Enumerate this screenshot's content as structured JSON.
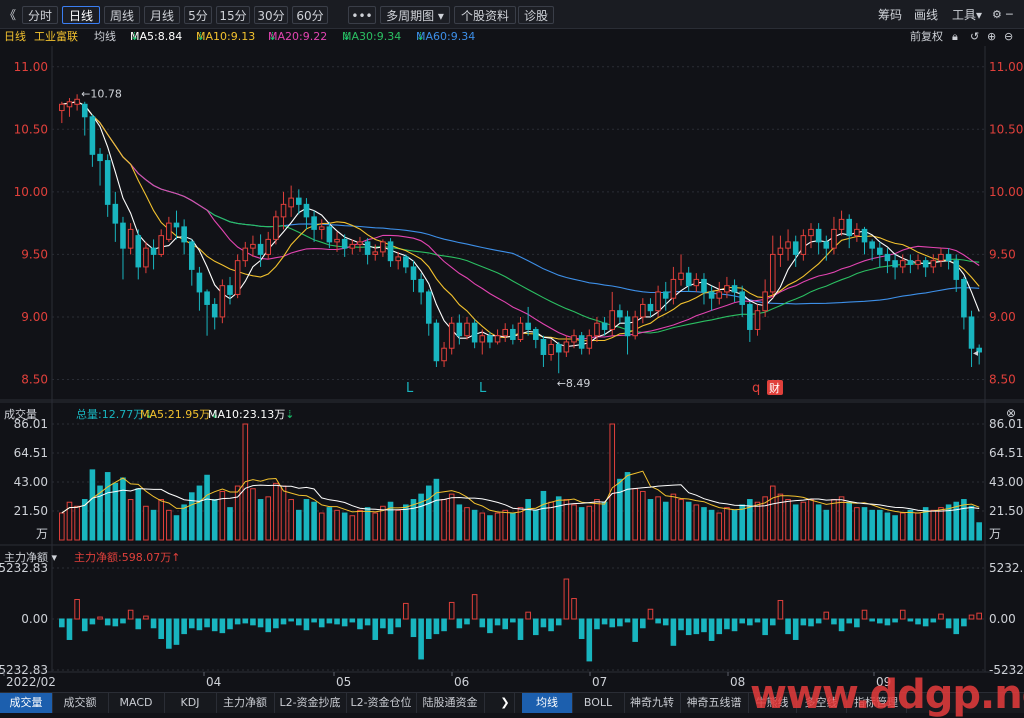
{
  "toolbar": {
    "back": "《",
    "periods": [
      "分时",
      "日线",
      "周线",
      "月线",
      "5分",
      "15分",
      "30分",
      "60分"
    ],
    "active_period": "日线",
    "more": "•••",
    "multi_period": "多周期图",
    "stock_info": "个股资料",
    "diagnose": "诊股",
    "right_items": [
      "筹码",
      "画线",
      "工具"
    ],
    "window_controls": [
      "⚙",
      "─",
      "▢",
      "✕"
    ]
  },
  "ribbon": {
    "period": "日线",
    "stock_name": "工业富联",
    "avg_label": "均线",
    "ma5": "MA5:8.84",
    "ma10": "MA10:9.13",
    "ma20": "MA20:9.22",
    "ma30": "MA30:9.34",
    "ma60": "MA60:9.34",
    "adjust": "前复权"
  },
  "colors": {
    "up": "#e0403b",
    "down": "#19b5bf",
    "ma5": "#ffffff",
    "ma10": "#f2c12e",
    "ma20": "#e244b1",
    "ma30": "#2bbf62",
    "ma60": "#3d8fe8",
    "grid": "#2a2d35",
    "axis_text": "#e0403b"
  },
  "price_panel": {
    "y_ticks": [
      "11.00",
      "10.50",
      "10.00",
      "9.50",
      "9.00",
      "8.50"
    ],
    "high_label": "10.78",
    "low_label": "8.49",
    "markers": [
      "L",
      "L",
      "q"
    ],
    "finance_badge": "财"
  },
  "volume_panel": {
    "title": "成交量",
    "total": "总量:12.77万",
    "ma5": "MA5:21.95万",
    "ma10": "MA10:23.13万",
    "y_ticks": [
      "86.01",
      "64.51",
      "43.00",
      "21.50",
      "万"
    ]
  },
  "flow_panel": {
    "title": "主力净额",
    "value": "主力净额:598.07万",
    "y_ticks": [
      "5232.83",
      "0.00",
      "-5232.83"
    ]
  },
  "x_axis": {
    "labels": [
      "2022/02",
      "04",
      "05",
      "06",
      "07",
      "08",
      "09"
    ]
  },
  "bottom_tabs_left": [
    "成交量",
    "成交额",
    "MACD",
    "KDJ",
    "主力净额",
    "L2-资金抄底",
    "L2-资金仓位",
    "陆股通资金"
  ],
  "bottom_tabs_right": [
    "均线",
    "BOLL",
    "神奇九转",
    "神奇五线谱",
    "牛熊线",
    "多空线",
    "指标管理"
  ],
  "active_left_tab": "成交量",
  "active_right_tab": "均线",
  "watermark": "www.ddgp.net",
  "chart_data": {
    "type": "candlestick",
    "title": "工业富联 日线",
    "price_range": [
      8.4,
      11.15
    ],
    "volume_range": [
      0,
      86.01
    ],
    "flow_range": [
      -5232.83,
      5232.83
    ],
    "candles": [
      [
        10.65,
        10.7,
        10.55,
        10.72,
        20
      ],
      [
        10.68,
        10.72,
        10.6,
        10.75,
        28
      ],
      [
        10.7,
        10.74,
        10.65,
        10.78,
        25
      ],
      [
        10.7,
        10.6,
        10.45,
        10.72,
        30
      ],
      [
        10.6,
        10.3,
        10.2,
        10.62,
        52
      ],
      [
        10.3,
        10.25,
        10.05,
        10.35,
        40
      ],
      [
        10.25,
        9.9,
        9.8,
        10.3,
        50
      ],
      [
        9.9,
        9.75,
        9.6,
        10.0,
        42
      ],
      [
        9.75,
        9.55,
        9.3,
        9.8,
        46
      ],
      [
        9.55,
        9.7,
        9.5,
        9.75,
        30
      ],
      [
        9.65,
        9.4,
        9.3,
        9.7,
        38
      ],
      [
        9.4,
        9.55,
        9.35,
        9.6,
        25
      ],
      [
        9.55,
        9.5,
        9.38,
        9.62,
        22
      ],
      [
        9.5,
        9.65,
        9.48,
        9.7,
        30
      ],
      [
        9.62,
        9.75,
        9.6,
        9.8,
        22
      ],
      [
        9.75,
        9.72,
        9.62,
        9.85,
        18
      ],
      [
        9.72,
        9.6,
        9.5,
        9.78,
        26
      ],
      [
        9.6,
        9.38,
        9.25,
        9.62,
        35
      ],
      [
        9.35,
        9.2,
        9.05,
        9.4,
        40
      ],
      [
        9.2,
        9.1,
        8.85,
        9.22,
        48
      ],
      [
        9.1,
        9.0,
        8.9,
        9.15,
        30
      ],
      [
        9.0,
        9.25,
        8.95,
        9.3,
        36
      ],
      [
        9.25,
        9.18,
        9.1,
        9.32,
        24
      ],
      [
        9.18,
        9.45,
        9.15,
        9.5,
        40
      ],
      [
        9.45,
        9.55,
        9.4,
        9.6,
        86
      ],
      [
        9.55,
        9.58,
        9.48,
        9.65,
        38
      ],
      [
        9.58,
        9.5,
        9.4,
        9.66,
        30
      ],
      [
        9.5,
        9.62,
        9.46,
        9.68,
        32
      ],
      [
        9.62,
        9.8,
        9.58,
        9.85,
        42
      ],
      [
        9.8,
        9.9,
        9.7,
        10.0,
        40
      ],
      [
        9.88,
        9.95,
        9.8,
        10.05,
        30
      ],
      [
        9.95,
        9.9,
        9.82,
        10.02,
        22
      ],
      [
        9.9,
        9.8,
        9.7,
        9.95,
        30
      ],
      [
        9.8,
        9.7,
        9.6,
        9.85,
        28
      ],
      [
        9.7,
        9.72,
        9.62,
        9.78,
        20
      ],
      [
        9.72,
        9.6,
        9.55,
        9.76,
        24
      ],
      [
        9.6,
        9.62,
        9.52,
        9.68,
        22
      ],
      [
        9.62,
        9.55,
        9.48,
        9.66,
        20
      ],
      [
        9.55,
        9.58,
        9.5,
        9.62,
        18
      ],
      [
        9.58,
        9.6,
        9.52,
        9.64,
        22
      ],
      [
        9.6,
        9.5,
        9.42,
        9.63,
        24
      ],
      [
        9.5,
        9.52,
        9.45,
        9.58,
        20
      ],
      [
        9.52,
        9.6,
        9.48,
        9.62,
        25
      ],
      [
        9.6,
        9.45,
        9.4,
        9.63,
        28
      ],
      [
        9.45,
        9.48,
        9.38,
        9.52,
        22
      ],
      [
        9.48,
        9.4,
        9.35,
        9.5,
        26
      ],
      [
        9.4,
        9.3,
        9.2,
        9.45,
        30
      ],
      [
        9.3,
        9.2,
        9.1,
        9.35,
        34
      ],
      [
        9.2,
        8.95,
        8.85,
        9.22,
        40
      ],
      [
        8.95,
        8.65,
        8.6,
        8.98,
        45
      ],
      [
        8.65,
        8.75,
        8.6,
        8.8,
        30
      ],
      [
        8.75,
        8.95,
        8.7,
        9.0,
        34
      ],
      [
        8.95,
        8.85,
        8.78,
        9.02,
        26
      ],
      [
        8.85,
        8.95,
        8.82,
        9.0,
        24
      ],
      [
        8.95,
        8.8,
        8.75,
        8.98,
        22
      ],
      [
        8.8,
        8.85,
        8.7,
        8.9,
        20
      ],
      [
        8.85,
        8.8,
        8.75,
        8.88,
        18
      ],
      [
        8.8,
        8.85,
        8.78,
        8.9,
        20
      ],
      [
        8.85,
        8.9,
        8.8,
        8.95,
        22
      ],
      [
        8.9,
        8.82,
        8.78,
        8.94,
        20
      ],
      [
        8.82,
        8.95,
        8.8,
        9.0,
        24
      ],
      [
        8.95,
        8.9,
        8.85,
        9.08,
        30
      ],
      [
        8.9,
        8.82,
        8.75,
        8.92,
        22
      ],
      [
        8.82,
        8.7,
        8.6,
        8.85,
        36
      ],
      [
        8.7,
        8.78,
        8.65,
        8.82,
        28
      ],
      [
        8.78,
        8.72,
        8.55,
        8.8,
        32
      ],
      [
        8.72,
        8.8,
        8.68,
        8.85,
        30
      ],
      [
        8.8,
        8.85,
        8.75,
        8.9,
        26
      ],
      [
        8.85,
        8.75,
        8.7,
        8.88,
        24
      ],
      [
        8.75,
        8.85,
        8.7,
        8.9,
        25
      ],
      [
        8.85,
        8.95,
        8.8,
        9.0,
        30
      ],
      [
        8.95,
        8.9,
        8.85,
        9.0,
        28
      ],
      [
        8.9,
        9.05,
        8.85,
        9.2,
        86
      ],
      [
        9.05,
        9.0,
        8.95,
        9.1,
        45
      ],
      [
        9.0,
        8.85,
        8.7,
        9.05,
        50
      ],
      [
        8.85,
        9.0,
        8.82,
        9.05,
        38
      ],
      [
        9.0,
        9.1,
        8.95,
        9.15,
        36
      ],
      [
        9.1,
        9.05,
        9.0,
        9.15,
        30
      ],
      [
        9.05,
        9.2,
        9.0,
        9.25,
        32
      ],
      [
        9.2,
        9.15,
        9.05,
        9.28,
        28
      ],
      [
        9.15,
        9.3,
        9.1,
        9.4,
        34
      ],
      [
        9.3,
        9.35,
        9.25,
        9.5,
        30
      ],
      [
        9.35,
        9.25,
        9.2,
        9.4,
        28
      ],
      [
        9.25,
        9.3,
        9.2,
        9.35,
        26
      ],
      [
        9.3,
        9.2,
        9.1,
        9.35,
        24
      ],
      [
        9.2,
        9.15,
        9.05,
        9.25,
        22
      ],
      [
        9.15,
        9.2,
        9.1,
        9.28,
        20
      ],
      [
        9.2,
        9.25,
        9.15,
        9.32,
        24
      ],
      [
        9.25,
        9.2,
        9.12,
        9.3,
        22
      ],
      [
        9.2,
        9.1,
        9.0,
        9.25,
        26
      ],
      [
        9.1,
        8.9,
        8.8,
        9.12,
        30
      ],
      [
        8.9,
        9.05,
        8.85,
        9.1,
        28
      ],
      [
        9.05,
        9.2,
        9.0,
        9.3,
        32
      ],
      [
        9.2,
        9.5,
        9.15,
        9.65,
        40
      ],
      [
        9.5,
        9.55,
        9.4,
        9.65,
        34
      ],
      [
        9.55,
        9.6,
        9.45,
        9.7,
        30
      ],
      [
        9.6,
        9.5,
        9.4,
        9.65,
        26
      ],
      [
        9.5,
        9.65,
        9.45,
        9.7,
        28
      ],
      [
        9.65,
        9.7,
        9.55,
        9.75,
        30
      ],
      [
        9.7,
        9.6,
        9.5,
        9.75,
        26
      ],
      [
        9.6,
        9.55,
        9.45,
        9.65,
        22
      ],
      [
        9.55,
        9.7,
        9.5,
        9.8,
        30
      ],
      [
        9.7,
        9.78,
        9.65,
        9.85,
        32
      ],
      [
        9.78,
        9.65,
        9.55,
        9.82,
        28
      ],
      [
        9.65,
        9.7,
        9.6,
        9.75,
        24
      ],
      [
        9.7,
        9.6,
        9.5,
        9.72,
        24
      ],
      [
        9.6,
        9.55,
        9.45,
        9.62,
        22
      ],
      [
        9.55,
        9.5,
        9.4,
        9.6,
        22
      ],
      [
        9.5,
        9.45,
        9.35,
        9.55,
        20
      ],
      [
        9.45,
        9.4,
        9.3,
        9.5,
        18
      ],
      [
        9.4,
        9.45,
        9.35,
        9.5,
        20
      ],
      [
        9.45,
        9.42,
        9.35,
        9.5,
        22
      ],
      [
        9.42,
        9.45,
        9.38,
        9.5,
        20
      ],
      [
        9.45,
        9.4,
        9.32,
        9.48,
        24
      ],
      [
        9.4,
        9.45,
        9.35,
        9.5,
        22
      ],
      [
        9.45,
        9.5,
        9.4,
        9.55,
        24
      ],
      [
        9.5,
        9.45,
        9.38,
        9.55,
        26
      ],
      [
        9.45,
        9.3,
        9.2,
        9.5,
        28
      ],
      [
        9.3,
        9.0,
        8.9,
        9.32,
        30
      ],
      [
        9.0,
        8.75,
        8.6,
        9.05,
        25
      ],
      [
        8.75,
        8.72,
        8.62,
        8.78,
        12.77
      ]
    ],
    "flow": [
      -800,
      -2100,
      2000,
      -1200,
      -500,
      200,
      -600,
      -700,
      -400,
      900,
      -1000,
      300,
      -900,
      -2000,
      -3000,
      -2600,
      -1500,
      -900,
      -1100,
      -800,
      -1200,
      -1400,
      -1000,
      -500,
      -400,
      -600,
      -800,
      -1300,
      -900,
      -500,
      -200,
      -600,
      -1100,
      -300,
      -800,
      -400,
      -500,
      -700,
      -300,
      -1000,
      -600,
      -2100,
      -900,
      -1500,
      -800,
      1600,
      -1800,
      -4100,
      -2000,
      -1500,
      -1200,
      1700,
      -900,
      -500,
      2500,
      -800,
      -1400,
      -600,
      -1000,
      -300,
      -2100,
      700,
      -1600,
      -800,
      -1200,
      -600,
      4100,
      2100,
      -2000,
      -4300,
      -1000,
      -500,
      -800,
      -700,
      -300,
      -2300,
      -900,
      1000,
      -400,
      -600,
      -2700,
      -1100,
      -1600,
      -1500,
      -1300,
      -2200,
      -1500,
      -1000,
      -1200,
      -400,
      -600,
      -300,
      -1600,
      -600,
      1900,
      -1500,
      -2100,
      -600,
      -700,
      -400,
      700,
      -500,
      -1200,
      -400,
      -800,
      900,
      -200,
      -400,
      -600,
      -300,
      900,
      -200,
      -500,
      -700,
      -300,
      500,
      -900,
      -1500,
      -700,
      400,
      598.07
    ]
  }
}
